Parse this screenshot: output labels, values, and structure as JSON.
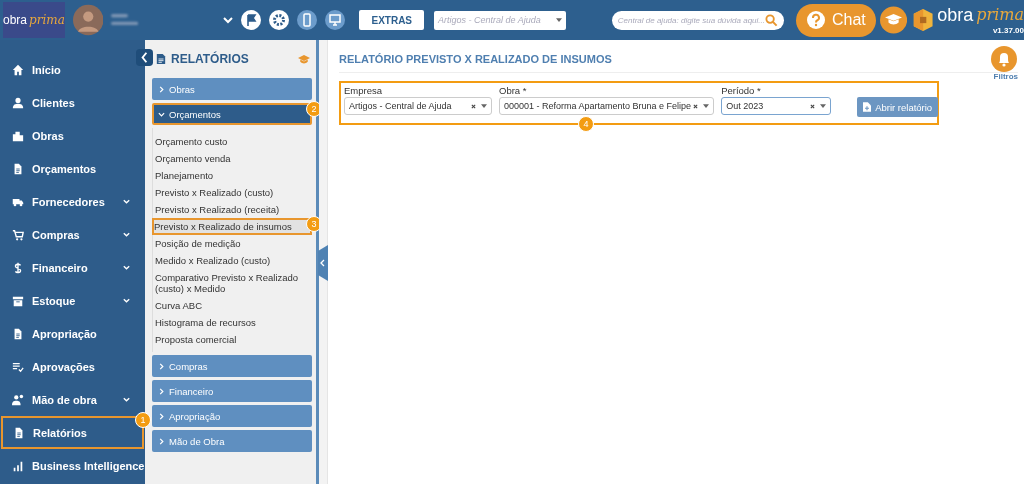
{
  "header": {
    "logo": {
      "word": "obra",
      "script": "prima"
    },
    "extras_button": "EXTRAS",
    "help_select": {
      "placeholder": "Artigos - Central de Ajuda"
    },
    "search": {
      "placeholder": "Central de ajuda: digite sua dúvida aqui..."
    },
    "chat_button": "Chat",
    "brand": {
      "word": "obra",
      "script": "prima",
      "version": "v1.37.00"
    }
  },
  "sidebar": {
    "items": [
      {
        "label": "Início",
        "submenu": false,
        "selected": false
      },
      {
        "label": "Clientes",
        "submenu": false,
        "selected": false
      },
      {
        "label": "Obras",
        "submenu": false,
        "selected": false
      },
      {
        "label": "Orçamentos",
        "submenu": false,
        "selected": false
      },
      {
        "label": "Fornecedores",
        "submenu": true,
        "selected": false
      },
      {
        "label": "Compras",
        "submenu": true,
        "selected": false
      },
      {
        "label": "Financeiro",
        "submenu": true,
        "selected": false
      },
      {
        "label": "Estoque",
        "submenu": true,
        "selected": false
      },
      {
        "label": "Apropriação",
        "submenu": false,
        "selected": false
      },
      {
        "label": "Aprovações",
        "submenu": false,
        "selected": false
      },
      {
        "label": "Mão de obra",
        "submenu": true,
        "selected": false
      },
      {
        "label": "Relatórios",
        "submenu": false,
        "selected": true,
        "callout": "1"
      },
      {
        "label": "Business Intelligence",
        "submenu": false,
        "selected": false
      }
    ]
  },
  "reports_panel": {
    "title": "RELATÓRIOS",
    "groups": [
      {
        "label": "Obras",
        "expanded": false
      },
      {
        "label": "Orçamentos",
        "expanded": true,
        "callout": "2",
        "children": [
          {
            "label": "Orçamento custo",
            "selected": false
          },
          {
            "label": "Orçamento venda",
            "selected": false
          },
          {
            "label": "Planejamento",
            "selected": false
          },
          {
            "label": "Previsto x Realizado (custo)",
            "selected": false
          },
          {
            "label": "Previsto x Realizado (receita)",
            "selected": false
          },
          {
            "label": "Previsto x Realizado de insumos",
            "selected": true,
            "callout": "3"
          },
          {
            "label": "Posição de medição",
            "selected": false
          },
          {
            "label": "Medido x Realizado (custo)",
            "selected": false
          },
          {
            "label": "Comparativo Previsto x Realizado (custo) x Medido",
            "selected": false
          },
          {
            "label": "Curva ABC",
            "selected": false
          },
          {
            "label": "Histograma de recursos",
            "selected": false
          },
          {
            "label": "Proposta comercial",
            "selected": false
          }
        ]
      },
      {
        "label": "Compras",
        "expanded": false
      },
      {
        "label": "Financeiro",
        "expanded": false
      },
      {
        "label": "Apropriação",
        "expanded": false
      },
      {
        "label": "Mão de Obra",
        "expanded": false
      }
    ]
  },
  "main": {
    "title": "RELATÓRIO PREVISTO X REALIZADO DE INSUMOS",
    "filters_label": "Filtros",
    "filters": [
      {
        "label": "Empresa",
        "value": "Artigos - Central de Ajuda",
        "focused": false
      },
      {
        "label": "Obra *",
        "value": "000001 - Reforma Apartamento Bruna e Felipe",
        "focused": false
      },
      {
        "label": "Período *",
        "value": "Out 2023",
        "focused": true
      }
    ],
    "open_button": "Abrir relatório",
    "callout": "4"
  }
}
